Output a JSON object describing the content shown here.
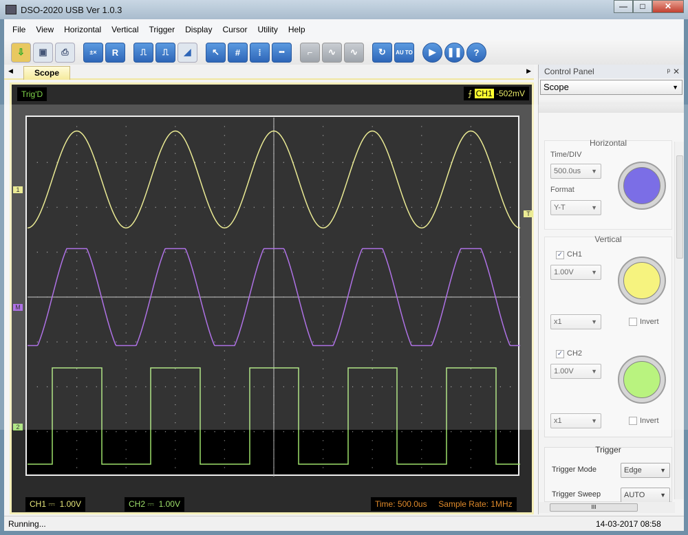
{
  "window": {
    "title": "DSO-2020 USB Ver 1.0.3",
    "min": "—",
    "max": "□",
    "close": "✕"
  },
  "menu": [
    "File",
    "View",
    "Horizontal",
    "Vertical",
    "Trigger",
    "Display",
    "Cursor",
    "Utility",
    "Help"
  ],
  "toolbar": [
    "open",
    "save",
    "print",
    "math",
    "R",
    "edge-trigger",
    "pulse-trigger",
    "slope",
    "pointer",
    "grid",
    "vertical-cursor",
    "horizontal-cursor",
    "step",
    "line",
    "sine",
    "refresh",
    "AU TO",
    "run",
    "pause",
    "?"
  ],
  "tabs": {
    "active": "Scope",
    "left": "◀",
    "right": "▶"
  },
  "scope": {
    "trig_status": "Trig'D",
    "trigger": {
      "channel": "CH1",
      "level": "-502mV",
      "edge": "rising"
    },
    "markers": {
      "ch1": "1",
      "ch2": "2",
      "math": "M",
      "trig": "T"
    },
    "ch1_info": {
      "label": "CH1",
      "coupling": "⎓",
      "scale": "1.00V"
    },
    "ch2_info": {
      "label": "CH2",
      "coupling": "⎓",
      "scale": "1.00V"
    },
    "time": "Time: 500.0us",
    "sample_rate": "Sample Rate: 1MHz",
    "colors": {
      "ch1": "#e6e67a",
      "ch2": "#9ee06a",
      "math": "#9b4fe0",
      "grid": "#888888"
    }
  },
  "panel": {
    "title": "Control Panel",
    "mode": "Scope",
    "horizontal": {
      "title": "Horizontal",
      "time_div_label": "Time/DIV",
      "time_div": "500.0us",
      "format_label": "Format",
      "format": "Y-T",
      "knob_color": "#5a4ae0"
    },
    "vertical": {
      "title": "Vertical",
      "ch1": {
        "label": "CH1",
        "checked": true,
        "scale": "1.00V",
        "probe": "x1",
        "invert": "Invert",
        "knob_color": "#f4f060"
      },
      "ch2": {
        "label": "CH2",
        "checked": true,
        "scale": "1.00V",
        "probe": "x1",
        "invert": "Invert",
        "knob_color": "#a8f060"
      }
    },
    "trigger": {
      "title": "Trigger",
      "mode_label": "Trigger Mode",
      "mode": "Edge",
      "sweep_label": "Trigger Sweep",
      "sweep": "AUTO"
    },
    "hscroll_thumb": "III"
  },
  "status": {
    "text": "Running...",
    "datetime": "14-03-2017  08:58"
  }
}
